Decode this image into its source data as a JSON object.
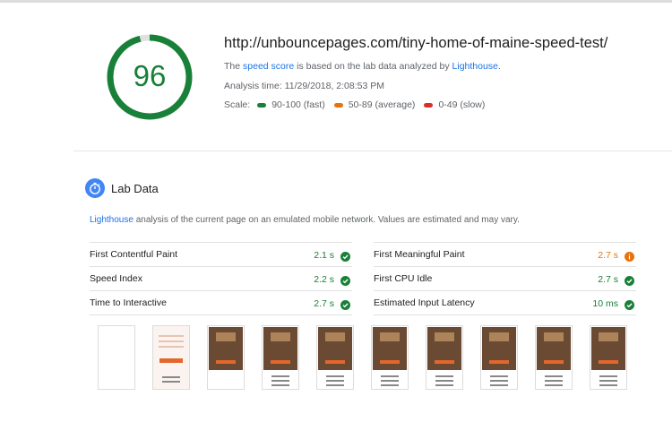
{
  "report": {
    "score": "96",
    "url": "http://unbouncepages.com/tiny-home-of-maine-speed-test/",
    "desc_prefix": "The ",
    "desc_link1": "speed score",
    "desc_middle": " is based on the lab data analyzed by ",
    "desc_link2": "Lighthouse",
    "desc_suffix": ".",
    "analysis_time": "Analysis time: 11/29/2018, 2:08:53 PM",
    "scale_label": "Scale:",
    "scale": [
      {
        "label": "90-100 (fast)",
        "color": "#188038"
      },
      {
        "label": "50-89 (average)",
        "color": "#e8710a"
      },
      {
        "label": "0-49 (slow)",
        "color": "#d93025"
      }
    ],
    "score_color": "#188038",
    "score_fraction": 0.96
  },
  "lab": {
    "title": "Lab Data",
    "icon": "stopwatch-icon",
    "desc_link": "Lighthouse",
    "desc_rest": " analysis of the current page on an emulated mobile network. Values are estimated and may vary.",
    "metrics_left": [
      {
        "name": "First Contentful Paint",
        "value": "2.1 s",
        "status": "pass"
      },
      {
        "name": "Speed Index",
        "value": "2.2 s",
        "status": "pass"
      },
      {
        "name": "Time to Interactive",
        "value": "2.7 s",
        "status": "pass"
      }
    ],
    "metrics_right": [
      {
        "name": "First Meaningful Paint",
        "value": "2.7 s",
        "status": "average"
      },
      {
        "name": "First CPU Idle",
        "value": "2.7 s",
        "status": "pass"
      },
      {
        "name": "Estimated Input Latency",
        "value": "10 ms",
        "status": "pass"
      }
    ],
    "pass_color": "#188038",
    "average_color": "#e8710a"
  },
  "filmstrip": {
    "frames": [
      "blank",
      "form",
      "hero",
      "hero",
      "hero",
      "hero",
      "hero",
      "hero",
      "hero",
      "hero"
    ]
  }
}
